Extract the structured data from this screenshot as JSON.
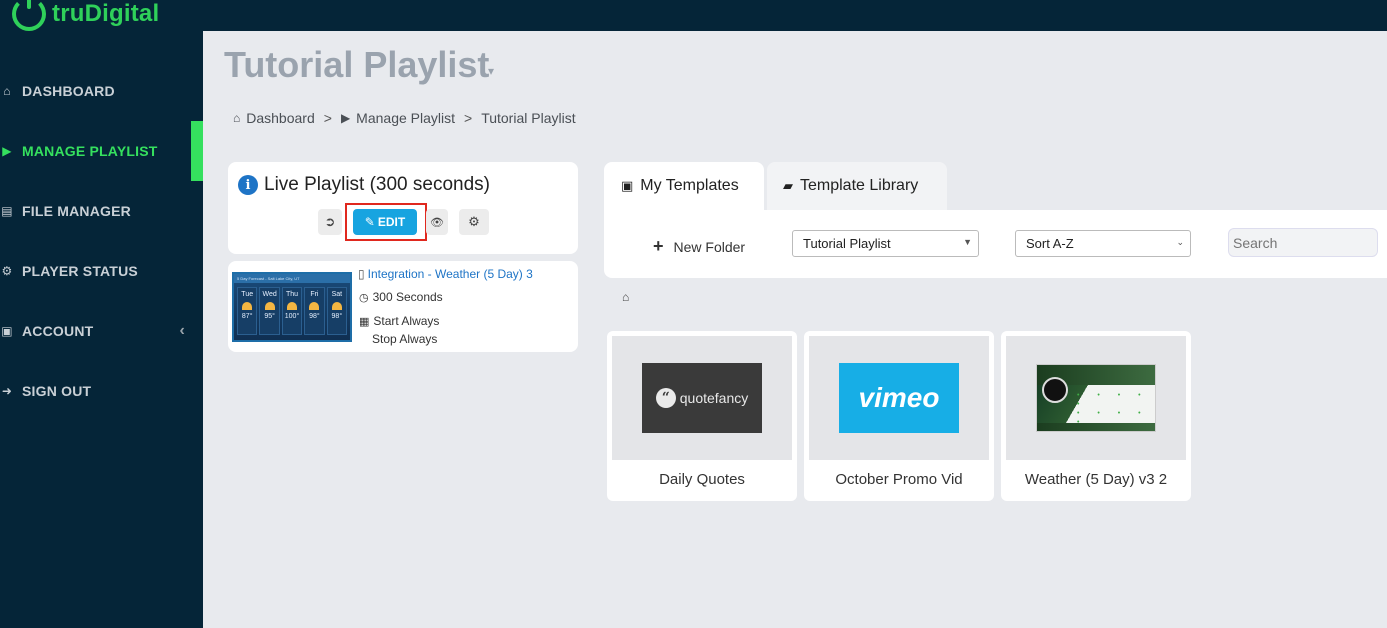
{
  "brand": {
    "name": "truDigital"
  },
  "sidebar": {
    "items": [
      {
        "label": "DASHBOARD",
        "icon": "home-icon",
        "glyph": "⌂"
      },
      {
        "label": "MANAGE PLAYLIST",
        "icon": "play-icon",
        "glyph": "▶"
      },
      {
        "label": "FILE MANAGER",
        "icon": "file-icon",
        "glyph": "▤"
      },
      {
        "label": "PLAYER STATUS",
        "icon": "cogs-icon",
        "glyph": "⚙"
      },
      {
        "label": "ACCOUNT",
        "icon": "briefcase-icon",
        "glyph": "▣"
      },
      {
        "label": "SIGN OUT",
        "icon": "sign-out-icon",
        "glyph": "➜"
      }
    ],
    "active_index": 1,
    "account_caret": "‹"
  },
  "page": {
    "title": "Tutorial Playlist",
    "title_caret": "▾"
  },
  "breadcrumb": {
    "items": [
      "Dashboard",
      "Manage Playlist",
      "Tutorial Playlist"
    ],
    "separator": ">"
  },
  "live_playlist": {
    "title": "Live Playlist (300 seconds)",
    "info_glyph": "i",
    "buttons": {
      "back_glyph": "➲",
      "edit_label": "EDIT",
      "edit_glyph": "✎",
      "preview_glyph": "👁",
      "settings_glyph": "⚙"
    }
  },
  "playlist_item": {
    "title": "Integration - Weather (5 Day) 3",
    "duration": "300 Seconds",
    "start": "Start Always",
    "stop": "Stop Always",
    "file_glyph": "▯",
    "clock_glyph": "◷",
    "calendar_glyph": "▦",
    "thumbnail": {
      "header": "5 Day Forecast - Salt Lake City, UT",
      "days": [
        {
          "day": "Tue",
          "temp": "87°"
        },
        {
          "day": "Wed",
          "temp": "95°"
        },
        {
          "day": "Thu",
          "temp": "100°"
        },
        {
          "day": "Fri",
          "temp": "98°"
        },
        {
          "day": "Sat",
          "temp": "98°"
        }
      ]
    }
  },
  "templates": {
    "tabs": [
      {
        "label": "My Templates",
        "icon": "briefcase-icon",
        "glyph": "▣"
      },
      {
        "label": "Template Library",
        "icon": "book-icon",
        "glyph": "▰"
      }
    ],
    "new_folder_label": "New Folder",
    "folder_select_value": "Tutorial Playlist",
    "sort_select_value": "Sort A-Z",
    "search_placeholder": "Search",
    "home_glyph": "⌂",
    "tiles": [
      {
        "label": "Daily Quotes",
        "thumb": "quotefancy",
        "thumb_text": "quotefancy"
      },
      {
        "label": "October Promo Vid",
        "thumb": "vimeo",
        "thumb_text": "vimeo"
      },
      {
        "label": "Weather (5 Day) v3 2",
        "thumb": "weather"
      }
    ]
  },
  "colors": {
    "sidebar_bg": "#052538",
    "accent_green": "#35e05e",
    "edit_blue": "#17a4e0",
    "highlight_red": "#e0281e",
    "link_blue": "#1e74c6"
  }
}
